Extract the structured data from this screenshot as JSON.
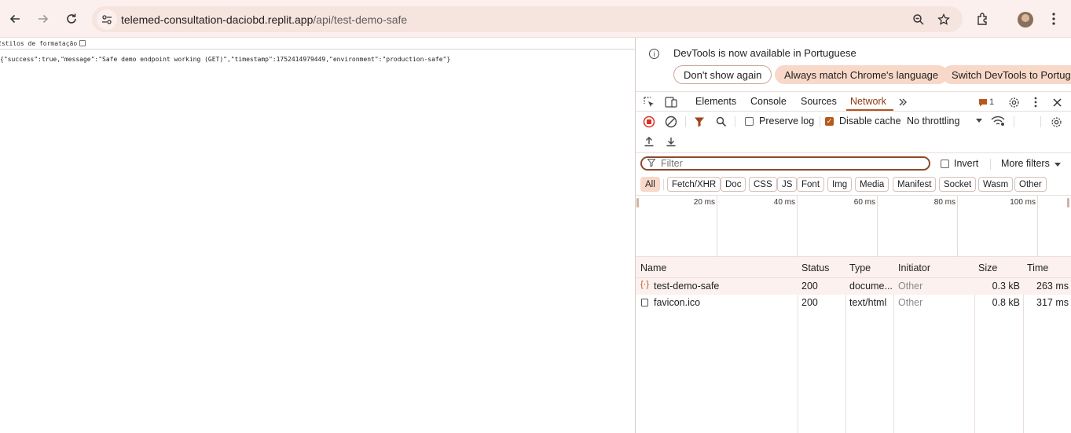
{
  "browser": {
    "url_host": "telemed-consultation-daciobd.replit.app",
    "url_path": "/api/test-demo-safe",
    "icons": [
      "back-icon",
      "forward-icon",
      "reload-icon",
      "site-settings-icon",
      "zoom-icon",
      "bookmark-star-icon",
      "extensions-icon",
      "avatar",
      "more-menu-icon"
    ]
  },
  "page": {
    "format_label": "Estilos de formatação",
    "json_text": "{\"success\":true,\"message\":\"Safe demo endpoint working (GET)\",\"timestamp\":1752414979449,\"environment\":\"production-safe\"}"
  },
  "devtools": {
    "infobar": {
      "message": "DevTools is now available in Portuguese",
      "dont_show": "Don't show again",
      "match_lang": "Always match Chrome's language",
      "switch": "Switch DevTools to Portuguese"
    },
    "tabs": {
      "elements": "Elements",
      "console": "Console",
      "sources": "Sources",
      "network": "Network",
      "issues_count": "1"
    },
    "controls": {
      "preserve_log": "Preserve log",
      "disable_cache": "Disable cache",
      "throttling": "No throttling"
    },
    "filter": {
      "placeholder": "Filter",
      "invert": "Invert",
      "more_filters": "More filters"
    },
    "chips": [
      "All",
      "Fetch/XHR",
      "Doc",
      "CSS",
      "JS",
      "Font",
      "Img",
      "Media",
      "Manifest",
      "Socket",
      "Wasm",
      "Other"
    ],
    "timeline": [
      "20 ms",
      "40 ms",
      "60 ms",
      "80 ms",
      "100 ms"
    ],
    "table": {
      "headers": {
        "name": "Name",
        "status": "Status",
        "type": "Type",
        "initiator": "Initiator",
        "size": "Size",
        "time": "Time"
      },
      "rows": [
        {
          "name": "test-demo-safe",
          "status": "200",
          "type": "docume...",
          "initiator": "Other",
          "size": "0.3 kB",
          "time": "263 ms"
        },
        {
          "name": "favicon.ico",
          "status": "200",
          "type": "text/html",
          "initiator": "Other",
          "size": "0.8 kB",
          "time": "317 ms"
        }
      ]
    },
    "accent_color": "#b5541f"
  }
}
